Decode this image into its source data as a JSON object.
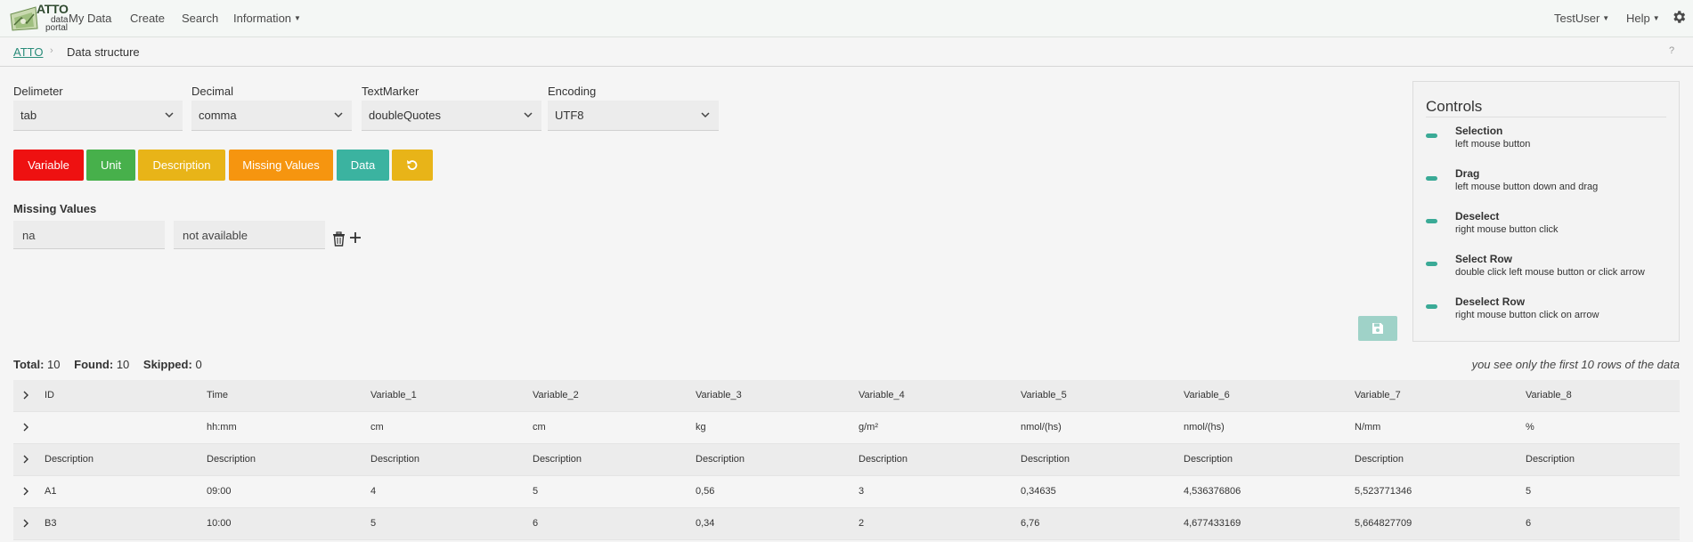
{
  "app": {
    "logo_title": "ATTO",
    "logo_line1": "data",
    "logo_line2": "portal"
  },
  "nav": {
    "items": [
      "My Data",
      "Create",
      "Search",
      "Information"
    ],
    "user": "TestUser",
    "help": "Help"
  },
  "breadcrumb": {
    "root": "ATTO",
    "separator": "›",
    "current": "Data structure",
    "help": "?"
  },
  "form": {
    "delimiter": {
      "label": "Delimeter",
      "value": "tab"
    },
    "decimal": {
      "label": "Decimal",
      "value": "comma"
    },
    "textmarker": {
      "label": "TextMarker",
      "value": "doubleQuotes"
    },
    "encoding": {
      "label": "Encoding",
      "value": "UTF8"
    }
  },
  "tag_buttons": {
    "variable": "Variable",
    "unit": "Unit",
    "description": "Description",
    "missing_values": "Missing Values",
    "data": "Data"
  },
  "colors": {
    "variable": "#ee1111",
    "unit": "#47b04b",
    "description": "#e8b418",
    "missing_values": "#f6950f",
    "data": "#3bb3a0",
    "reset": "#e8b418",
    "accent": "#3aaa96"
  },
  "missing_values": {
    "title": "Missing Values",
    "code": "na",
    "description": "not available"
  },
  "controls": {
    "title": "Controls",
    "items": [
      {
        "name": "Selection",
        "desc": "left mouse button"
      },
      {
        "name": "Drag",
        "desc": "left mouse button down and drag"
      },
      {
        "name": "Deselect",
        "desc": "right mouse button click"
      },
      {
        "name": "Select Row",
        "desc": "double click left mouse button or click arrow"
      },
      {
        "name": "Deselect Row",
        "desc": "right mouse button click on arrow"
      }
    ]
  },
  "stats": {
    "total_label": "Total:",
    "total": "10",
    "found_label": "Found:",
    "found": "10",
    "skipped_label": "Skipped:",
    "skipped": "0",
    "hint": "you see only the first 10 rows of the data"
  },
  "table": {
    "rows": [
      [
        "ID",
        "Time",
        "Variable_1",
        "Variable_2",
        "Variable_3",
        "Variable_4",
        "Variable_5",
        "Variable_6",
        "Variable_7",
        "Variable_8"
      ],
      [
        "",
        "hh:mm",
        "cm",
        "cm",
        "kg",
        "g/m²",
        "nmol/(hs)",
        "nmol/(hs)",
        "N/mm",
        "%"
      ],
      [
        "Description",
        "Description",
        "Description",
        "Description",
        "Description",
        "Description",
        "Description",
        "Description",
        "Description",
        "Description"
      ],
      [
        "A1",
        "09:00",
        "4",
        "5",
        "0,56",
        "3",
        "0,34635",
        "4,536376806",
        "5,523771346",
        "5"
      ],
      [
        "B3",
        "10:00",
        "5",
        "6",
        "0,34",
        "2",
        "6,76",
        "4,677433169",
        "5,664827709",
        "6"
      ]
    ]
  }
}
